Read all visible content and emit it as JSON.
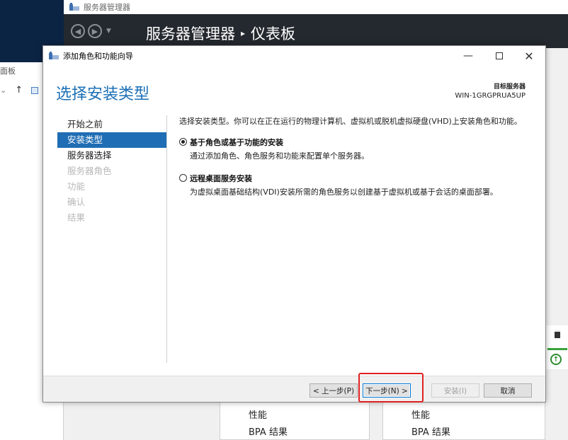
{
  "explorer": {
    "title_fragment": "面板"
  },
  "server_manager": {
    "window_title": "服务器管理器",
    "breadcrumb_app": "服务器管理器",
    "breadcrumb_sep": "▸",
    "breadcrumb_page": "仪表板",
    "tiles": [
      {
        "line1": "性能",
        "line2": "BPA 结果"
      },
      {
        "line1": "性能",
        "line2": "BPA 结果"
      }
    ]
  },
  "wizard": {
    "window_title": "添加角色和功能向导",
    "heading": "选择安装类型",
    "target_label": "目标服务器",
    "target_value": "WIN-1GRGPRUA5UP",
    "steps": [
      {
        "label": "开始之前",
        "state": "normal"
      },
      {
        "label": "安装类型",
        "state": "active"
      },
      {
        "label": "服务器选择",
        "state": "normal"
      },
      {
        "label": "服务器角色",
        "state": "disabled"
      },
      {
        "label": "功能",
        "state": "disabled"
      },
      {
        "label": "确认",
        "state": "disabled"
      },
      {
        "label": "结果",
        "state": "disabled"
      }
    ],
    "description": "选择安装类型。你可以在正在运行的物理计算机、虚拟机或脱机虚拟硬盘(VHD)上安装角色和功能。",
    "options": [
      {
        "label": "基于角色或基于功能的安装",
        "desc": "通过添加角色、角色服务和功能来配置单个服务器。",
        "checked": true
      },
      {
        "label": "远程桌面服务安装",
        "desc": "为虚拟桌面基础结构(VDI)安装所需的角色服务以创建基于虚拟机或基于会话的桌面部署。",
        "checked": false
      }
    ],
    "buttons": {
      "prev": "< 上一步(P)",
      "next": "下一步(N) >",
      "install": "安装(I)",
      "cancel": "取消"
    }
  },
  "colors": {
    "accent": "#1f6db4",
    "heading": "#1b6fb5",
    "highlight": "#e02020",
    "header_dark": "#24292f"
  }
}
